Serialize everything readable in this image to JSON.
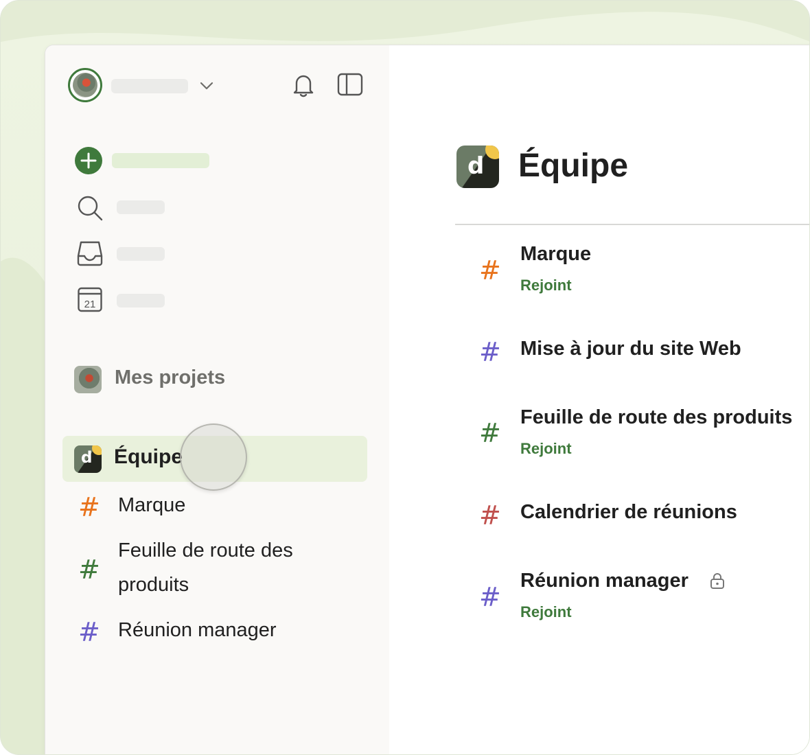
{
  "sidebar": {
    "projects_label": "Mes projets",
    "team_label": "Équipe",
    "items": [
      {
        "label": "Marque",
        "color": "#e8731c"
      },
      {
        "label": "Feuille de route des produits",
        "color": "#3f7a3c"
      },
      {
        "label": "Réunion manager",
        "color": "#6b5ec9"
      }
    ]
  },
  "main": {
    "title": "Équipe",
    "projects": [
      {
        "name": "Marque",
        "status": "Rejoint",
        "color": "#e8731c"
      },
      {
        "name": "Mise à jour du site Web",
        "status": "",
        "color": "#6b5ec9"
      },
      {
        "name": "Feuille de route des produits",
        "status": "Rejoint",
        "color": "#3f7a3c"
      },
      {
        "name": "Calendrier de réunions",
        "status": "",
        "color": "#c0504d"
      },
      {
        "name": "Réunion manager",
        "status": "Rejoint",
        "color": "#6b5ec9",
        "locked": true
      }
    ]
  },
  "icons": {
    "header": [
      "avatar",
      "chevron-down-icon",
      "bell-icon",
      "sidebar-toggle-icon"
    ],
    "nav": [
      "add-task-icon",
      "search-icon",
      "inbox-icon",
      "calendar-icon"
    ],
    "calendar_day": "21",
    "hash_glyph": "#",
    "logo_letter": "d"
  },
  "colors": {
    "accent": "#3f7a3c",
    "team_highlight": "#e9f1dc"
  }
}
